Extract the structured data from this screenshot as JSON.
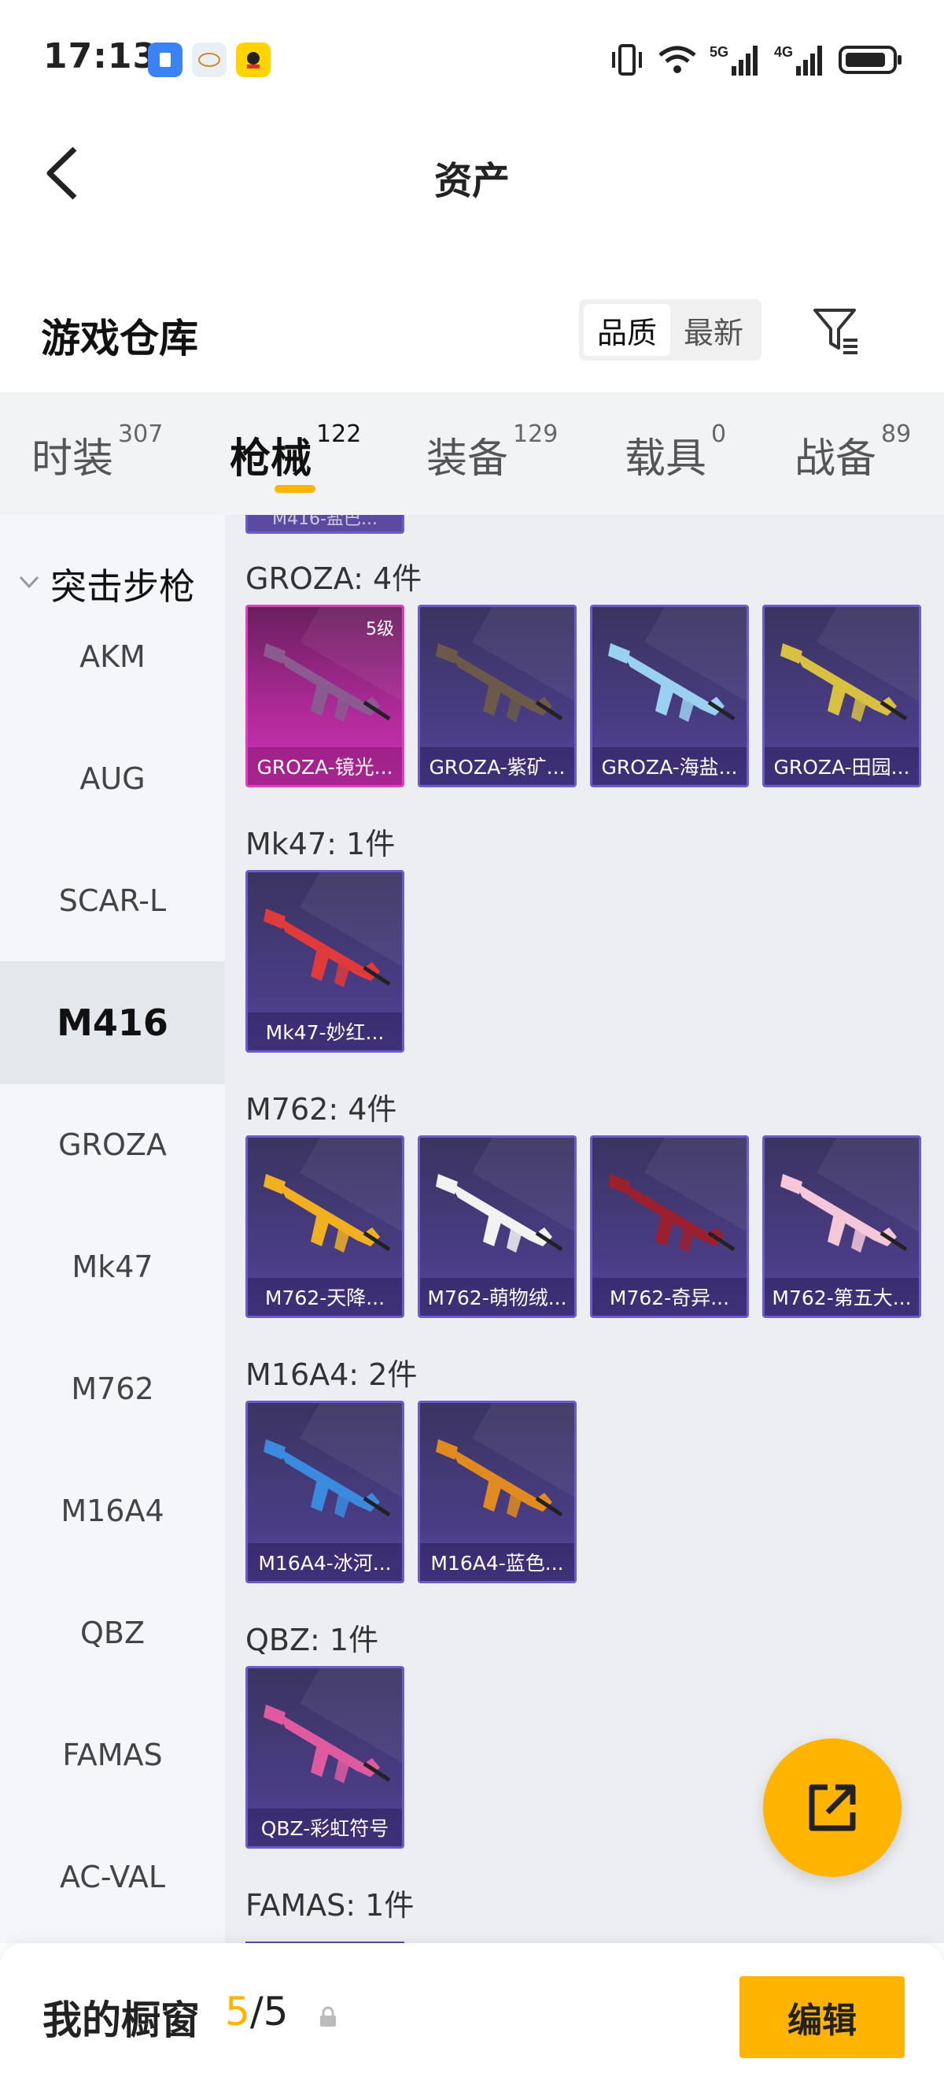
{
  "status": {
    "time": "17:13",
    "app_icons": [
      "app-icon-blue",
      "app-icon-yoyo",
      "app-icon-yellow"
    ],
    "net1": "5G",
    "net2": "4G"
  },
  "nav": {
    "title": "资产"
  },
  "header": {
    "title": "游戏仓库",
    "sort_options": [
      "品质",
      "最新"
    ],
    "sort_selected": "品质"
  },
  "tabs": [
    {
      "label": "时装",
      "count": "307"
    },
    {
      "label": "枪械",
      "count": "122"
    },
    {
      "label": "装备",
      "count": "129"
    },
    {
      "label": "载具",
      "count": "0"
    },
    {
      "label": "战备",
      "count": "89"
    }
  ],
  "active_tab": "枪械",
  "sidebar": {
    "group": "突击步枪",
    "items": [
      "AKM",
      "AUG",
      "SCAR-L",
      "M416",
      "GROZA",
      "Mk47",
      "M762",
      "M16A4",
      "QBZ",
      "FAMAS",
      "AC-VAL"
    ],
    "active": "M416"
  },
  "content": {
    "partial_top_label": "M416-盐巴...",
    "sections": [
      {
        "title": "GROZA: 4件",
        "cards": [
          {
            "name": "GROZA-镜光...",
            "level": "5级",
            "accent": "#d033b6",
            "gun_color": "#8a5a90"
          },
          {
            "name": "GROZA-紫矿...",
            "accent": "#6e5ad0",
            "gun_color": "#6b5a4a"
          },
          {
            "name": "GROZA-海盐...",
            "accent": "#6e5ad0",
            "gun_color": "#9ad0f0"
          },
          {
            "name": "GROZA-田园...",
            "accent": "#6e5ad0",
            "gun_color": "#d8c040"
          }
        ]
      },
      {
        "title": "Mk47: 1件",
        "cards": [
          {
            "name": "Mk47-妙红...",
            "accent": "#6e5ad0",
            "gun_color": "#e03a3a"
          }
        ]
      },
      {
        "title": "M762: 4件",
        "cards": [
          {
            "name": "M762-天降...",
            "accent": "#6e5ad0",
            "gun_color": "#f0b020"
          },
          {
            "name": "M762-萌物绒...",
            "accent": "#6e5ad0",
            "gun_color": "#f2f2f2"
          },
          {
            "name": "M762-奇异...",
            "accent": "#6e5ad0",
            "gun_color": "#9a2030"
          },
          {
            "name": "M762-第五大...",
            "accent": "#6e5ad0",
            "gun_color": "#f4c8d8"
          }
        ]
      },
      {
        "title": "M16A4: 2件",
        "cards": [
          {
            "name": "M16A4-冰河...",
            "accent": "#6e5ad0",
            "gun_color": "#3a8ae0"
          },
          {
            "name": "M16A4-蓝色...",
            "accent": "#6e5ad0",
            "gun_color": "#e08a20"
          }
        ]
      },
      {
        "title": "QBZ: 1件",
        "cards": [
          {
            "name": "QBZ-彩虹符号",
            "accent": "#6e5ad0",
            "gun_color": "#e05aa0"
          }
        ]
      },
      {
        "title": "FAMAS: 1件",
        "cards": []
      }
    ]
  },
  "bottom": {
    "label": "我的橱窗",
    "count_current": "5",
    "count_sep": "/",
    "count_total": "5",
    "edit_label": "编辑"
  },
  "colors": {
    "accent": "#ffb400",
    "card_border": "#6e5ad0"
  }
}
